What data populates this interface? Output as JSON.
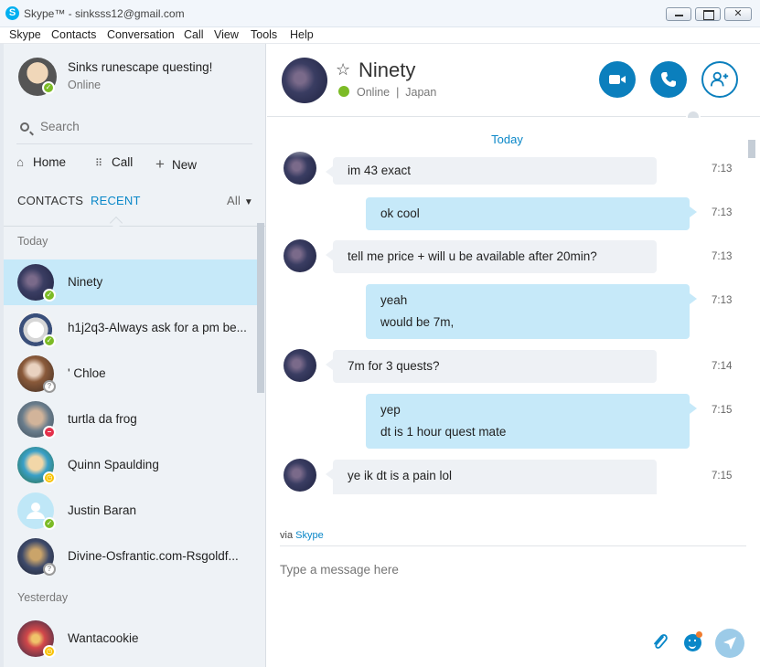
{
  "window": {
    "title": "Skype™ - sinksss12@gmail.com",
    "logo_letter": "S"
  },
  "menu": [
    "Skype",
    "Contacts",
    "Conversation",
    "Call",
    "View",
    "Tools",
    "Help"
  ],
  "profile": {
    "name": "Sinks runescape questing!",
    "status": "Online"
  },
  "search": {
    "placeholder": "Search"
  },
  "nav": {
    "home": "Home",
    "call": "Call",
    "new": "New"
  },
  "tabs": {
    "contacts": "CONTACTS",
    "recent": "RECENT",
    "filter": "All"
  },
  "groups": {
    "today": "Today",
    "yesterday": "Yesterday"
  },
  "contacts": [
    {
      "name": "Ninety",
      "status": "online"
    },
    {
      "name": "h1j2q3-Always ask for a pm be...",
      "status": "online"
    },
    {
      "name": "' Chloe",
      "status": "offline"
    },
    {
      "name": "turtla da frog",
      "status": "dnd"
    },
    {
      "name": "Quinn Spaulding",
      "status": "away"
    },
    {
      "name": "Justin Baran",
      "status": "online"
    },
    {
      "name": "Divine-Osfrantic.com-Rsgoldf...",
      "status": "offline"
    },
    {
      "name": "Wantacookie",
      "status": "away"
    }
  ],
  "conversation": {
    "name": "Ninety",
    "presence": "Online",
    "location": "Japan",
    "day_label": "Today",
    "messages": [
      {
        "from": "them",
        "lines": [
          "im 43 exact"
        ],
        "time": "7:13"
      },
      {
        "from": "me",
        "lines": [
          "ok cool"
        ],
        "time": "7:13"
      },
      {
        "from": "them",
        "lines": [
          "tell me price + will u be available after 20min?"
        ],
        "time": "7:13"
      },
      {
        "from": "me",
        "lines": [
          "yeah",
          "would be 7m,"
        ],
        "time": "7:13"
      },
      {
        "from": "them",
        "lines": [
          "7m for 3 quests?"
        ],
        "time": "7:14"
      },
      {
        "from": "me",
        "lines": [
          "yep",
          "dt is 1 hour quest mate"
        ],
        "time": "7:15"
      },
      {
        "from": "them",
        "lines": [
          "ye ik dt is a pain lol"
        ],
        "time": "7:15"
      }
    ]
  },
  "compose": {
    "via_prefix": "via",
    "via_link": "Skype",
    "placeholder": "Type a message here"
  },
  "colors": {
    "accent": "#0b7fbd",
    "online": "#7cbb26",
    "away": "#f8c200",
    "dnd": "#e4304b",
    "selected_row": "#c6e9f9"
  }
}
